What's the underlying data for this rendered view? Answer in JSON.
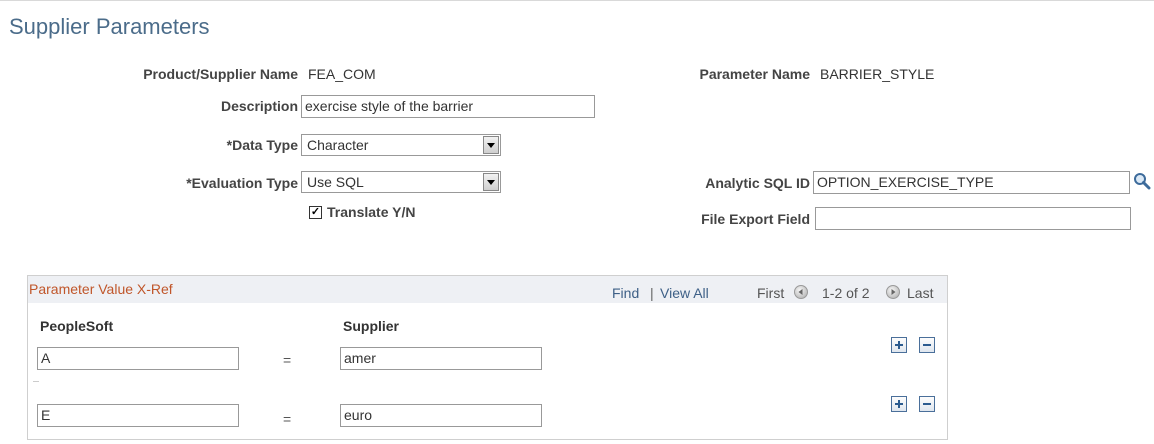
{
  "page": {
    "title": "Supplier Parameters"
  },
  "form": {
    "product_supplier_name_label": "Product/Supplier Name",
    "product_supplier_name_value": "FEA_COM",
    "parameter_name_label": "Parameter Name",
    "parameter_name_value": "BARRIER_STYLE",
    "description_label": "Description",
    "description_value": "exercise style of the barrier",
    "data_type_label": "*Data Type",
    "data_type_value": "Character",
    "evaluation_type_label": "*Evaluation Type",
    "evaluation_type_value": "Use SQL",
    "translate_label": "Translate Y/N",
    "translate_checked": true,
    "analytic_sql_id_label": "Analytic SQL ID",
    "analytic_sql_id_value": "OPTION_EXERCISE_TYPE",
    "file_export_field_label": "File Export Field",
    "file_export_field_value": ""
  },
  "grid": {
    "title": "Parameter Value X-Ref",
    "find_label": "Find",
    "separator": "|",
    "view_all_label": "View All",
    "first_label": "First",
    "range_label": "1-2 of 2",
    "last_label": "Last",
    "columns": {
      "peoplesoft": "PeopleSoft",
      "supplier": "Supplier"
    },
    "equals": "=",
    "rows": [
      {
        "peoplesoft": "A",
        "supplier": "amer"
      },
      {
        "peoplesoft": "E",
        "supplier": "euro"
      }
    ]
  },
  "icons": {
    "lookup": "magnifier-icon",
    "prev": "prev-arrow-icon",
    "next": "next-arrow-icon",
    "add": "plus-icon",
    "delete": "minus-icon"
  },
  "colors": {
    "title": "#4b6c8a",
    "grid_title": "#c0562a",
    "link": "#3d5f86"
  }
}
